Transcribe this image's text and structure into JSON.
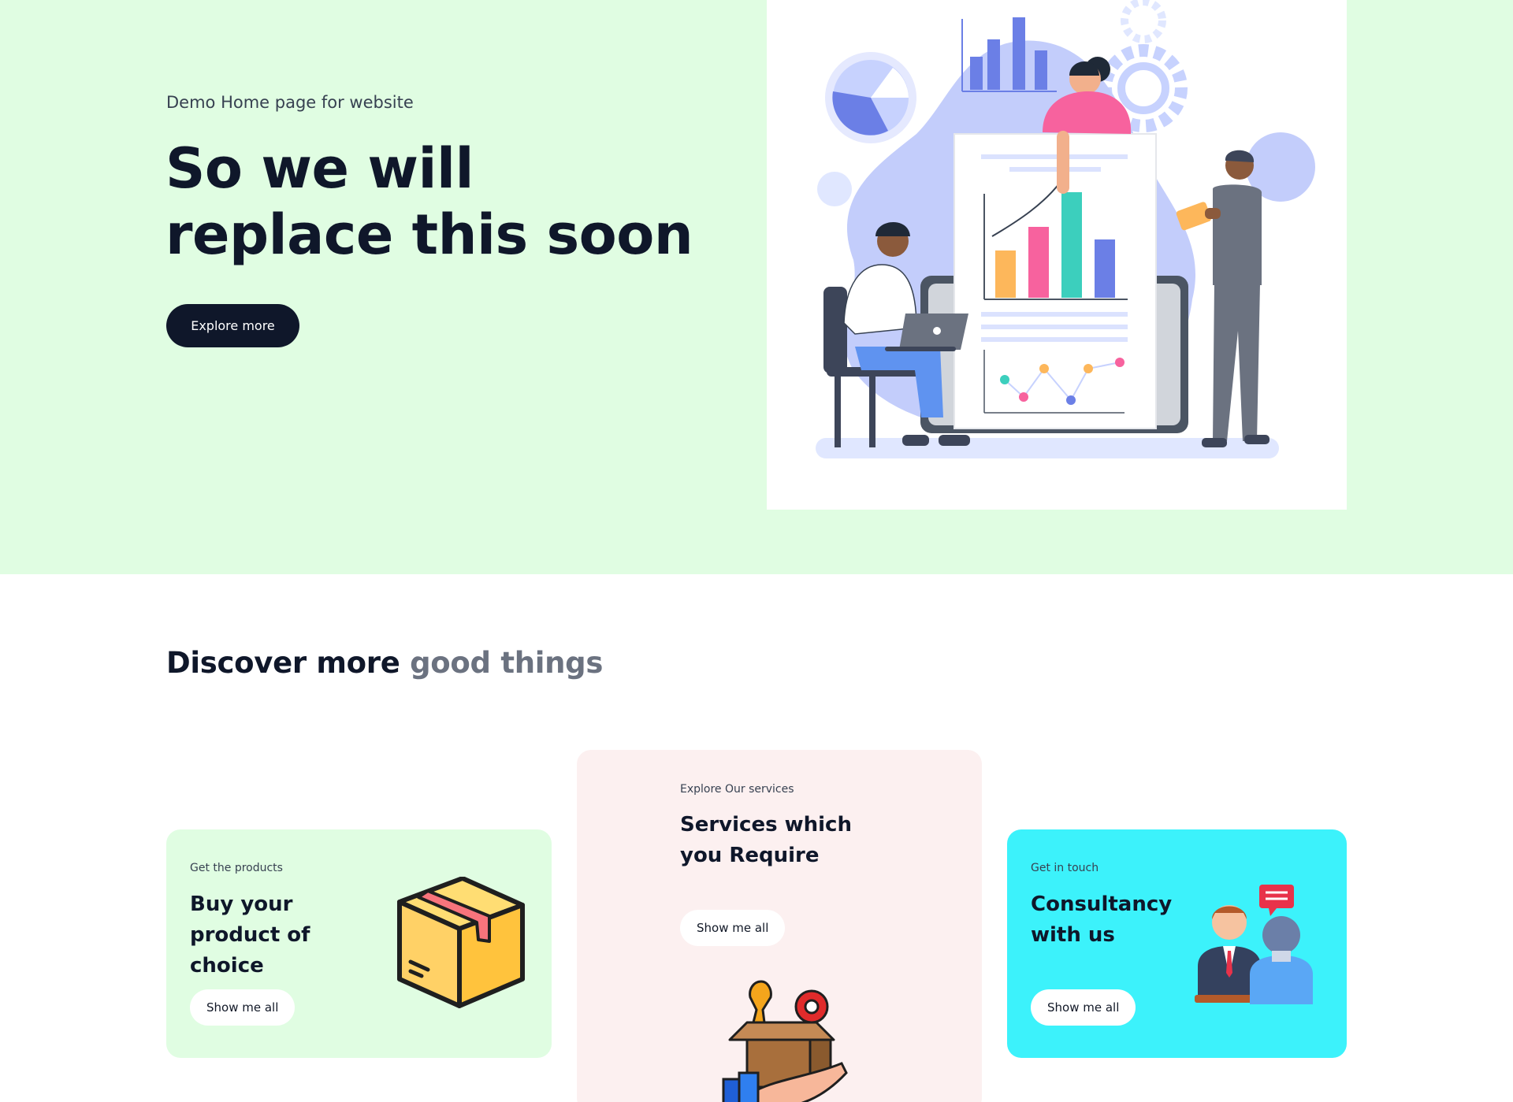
{
  "hero": {
    "eyebrow": "Demo Home page for website",
    "title": "So we will replace this soon",
    "cta_label": "Explore more",
    "background": "#e0fde2",
    "cta_color": "#0f172a"
  },
  "discover": {
    "title_main": "Discover more",
    "title_muted": "good things"
  },
  "cards": [
    {
      "eyebrow": "Get the products",
      "title": "Buy your product of choice",
      "button_label": "Show me all",
      "icon": "package-box-icon",
      "background": "#e0fde2"
    },
    {
      "eyebrow": "Explore Our services",
      "title": "Services which you Require",
      "button_label": "Show me all",
      "icon": "service-tools-box-icon",
      "background": "#fcf0f0"
    },
    {
      "eyebrow": "Get in touch",
      "title": "Consultancy with us",
      "button_label": "Show me all",
      "icon": "consultancy-people-icon",
      "background": "#3cf2fb"
    }
  ]
}
